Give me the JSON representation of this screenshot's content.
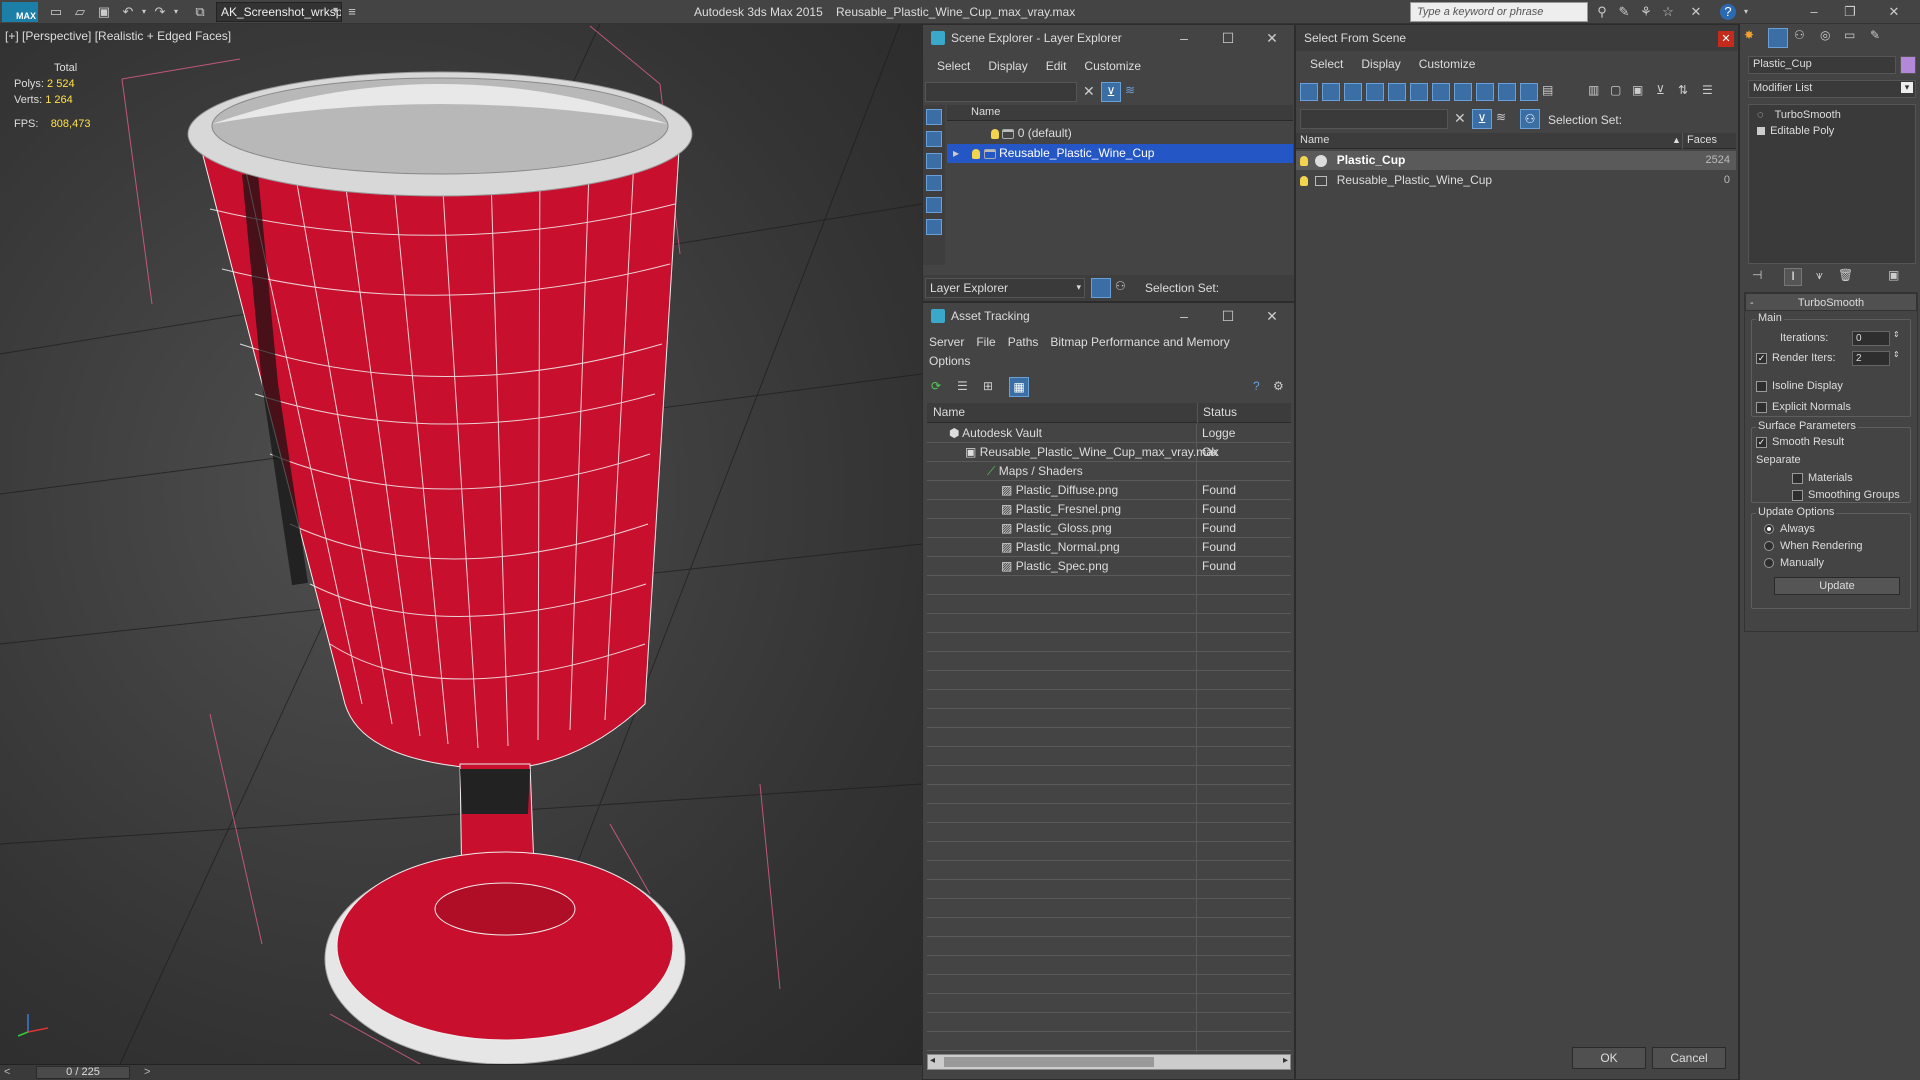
{
  "titlebar": {
    "app_title": "Autodesk 3ds Max  2015",
    "file_title": "Reusable_Plastic_Wine_Cup_max_vray.max",
    "workspace": "AK_Screenshot_wrksp",
    "search_placeholder": "Type a keyword or phrase",
    "logo": "MAX"
  },
  "viewport": {
    "label": "[+] [Perspective] [Realistic + Edged Faces]",
    "stats": {
      "total_label": "Total",
      "polys_label": "Polys:",
      "polys": "2 524",
      "verts_label": "Verts:",
      "verts": "1 264",
      "fps_label": "FPS:",
      "fps": "808,473"
    },
    "cup_color": "#c8102e"
  },
  "timeline": {
    "frame": "0 / 225"
  },
  "scene_explorer": {
    "title": "Scene Explorer - Layer Explorer",
    "menu": [
      "Select",
      "Display",
      "Edit",
      "Customize"
    ],
    "col_name": "Name",
    "rows": [
      "0 (default)",
      "Reusable_Plastic_Wine_Cup"
    ],
    "footer_dropdown": "Layer Explorer",
    "selection_set": "Selection Set:"
  },
  "asset_tracking": {
    "title": "Asset Tracking",
    "menu": [
      "Server",
      "File",
      "Paths",
      "Bitmap Performance and Memory"
    ],
    "menu2": "Options",
    "col_name": "Name",
    "col_status": "Status",
    "rows": [
      {
        "name": "Autodesk Vault",
        "status": "Logge"
      },
      {
        "name": "Reusable_Plastic_Wine_Cup_max_vray.max",
        "status": "Ok"
      },
      {
        "name": "Maps / Shaders",
        "status": ""
      },
      {
        "name": "Plastic_Diffuse.png",
        "status": "Found"
      },
      {
        "name": "Plastic_Fresnel.png",
        "status": "Found"
      },
      {
        "name": "Plastic_Gloss.png",
        "status": "Found"
      },
      {
        "name": "Plastic_Normal.png",
        "status": "Found"
      },
      {
        "name": "Plastic_Spec.png",
        "status": "Found"
      }
    ]
  },
  "select_from_scene": {
    "title": "Select From Scene",
    "menu": [
      "Select",
      "Display",
      "Customize"
    ],
    "selection_set": "Selection Set:",
    "col_name": "Name",
    "col_faces": "Faces",
    "rows": [
      {
        "name": "Plastic_Cup",
        "faces": "2524"
      },
      {
        "name": "Reusable_Plastic_Wine_Cup",
        "faces": "0"
      }
    ],
    "ok": "OK",
    "cancel": "Cancel"
  },
  "command_panel": {
    "object_name": "Plastic_Cup",
    "modifier_list": "Modifier List",
    "stack": [
      "TurboSmooth",
      "Editable Poly"
    ],
    "rollout": "TurboSmooth",
    "main": "Main",
    "iterations_label": "Iterations:",
    "iterations": "0",
    "render_iters_label": "Render Iters:",
    "render_iters": "2",
    "isoline": "Isoline Display",
    "explicit": "Explicit Normals",
    "surface_params": "Surface Parameters",
    "smooth_result": "Smooth Result",
    "separate": "Separate",
    "materials": "Materials",
    "smoothing_groups": "Smoothing Groups",
    "update_options": "Update Options",
    "always": "Always",
    "when_rendering": "When Rendering",
    "manually": "Manually",
    "update": "Update"
  }
}
